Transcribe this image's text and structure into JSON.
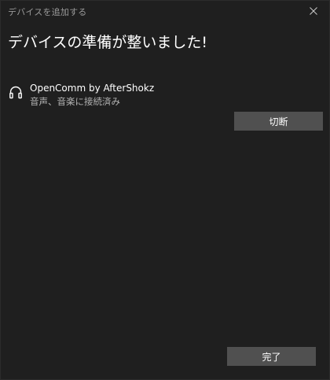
{
  "window": {
    "title": "デバイスを追加する",
    "close_icon": "close-icon"
  },
  "heading": "デバイスの準備が整いました!",
  "device": {
    "icon": "headphones-icon",
    "name": "OpenComm by AfterShokz",
    "status": "音声、音楽に接続済み"
  },
  "buttons": {
    "disconnect_label": "切断",
    "done_label": "完了"
  },
  "colors": {
    "background": "#1f1f1f",
    "button": "#505050",
    "secondary_text": "#b4b4b4"
  }
}
